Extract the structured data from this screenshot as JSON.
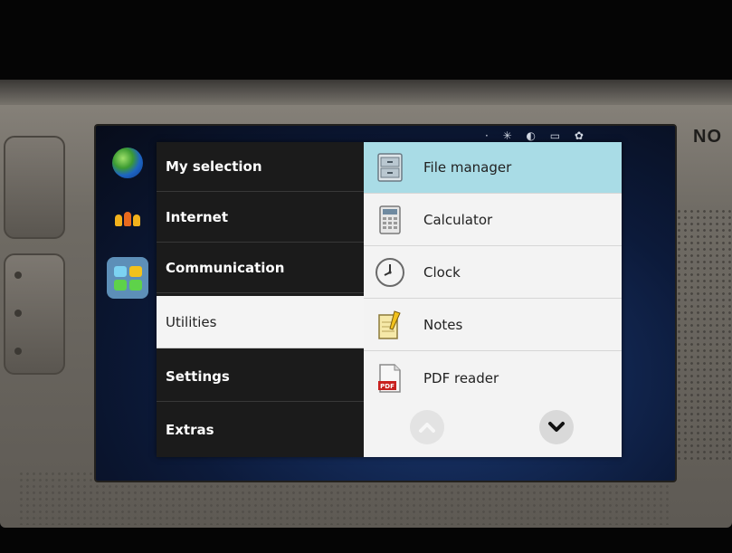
{
  "device": {
    "brand": "NO"
  },
  "status_bar": {
    "indicators": "·  ✳ ◐ ▭ ✿"
  },
  "launcher": {
    "items": [
      {
        "icon": "globe-icon"
      },
      {
        "icon": "contacts-people-icon"
      },
      {
        "icon": "applications-grid-icon",
        "active": true
      }
    ]
  },
  "menu": {
    "categories": [
      {
        "label": "My selection"
      },
      {
        "label": "Internet"
      },
      {
        "label": "Communication"
      },
      {
        "label": "Utilities",
        "selected": true
      },
      {
        "label": "Settings"
      },
      {
        "label": "Extras"
      }
    ],
    "apps": [
      {
        "label": "File manager",
        "icon": "file-cabinet-icon",
        "highlighted": true
      },
      {
        "label": "Calculator",
        "icon": "calculator-icon"
      },
      {
        "label": "Clock",
        "icon": "clock-icon"
      },
      {
        "label": "Notes",
        "icon": "notes-pencil-icon"
      },
      {
        "label": "PDF reader",
        "icon": "pdf-document-icon"
      }
    ],
    "pdf_badge": "PDF"
  },
  "colors": {
    "category_background": "#1b1b1b",
    "highlight": "#a9dce6",
    "launcher_active": "#5d8fb8"
  }
}
